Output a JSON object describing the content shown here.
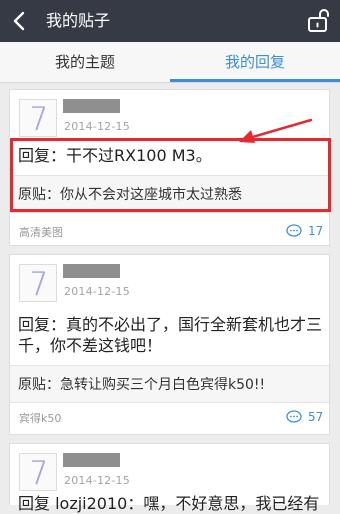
{
  "header": {
    "title": "我的贴子",
    "back_icon": "back-arrow-icon",
    "lock_icon": "lock-icon"
  },
  "tabs": [
    {
      "label": "我的主题",
      "active": false
    },
    {
      "label": "我的回复",
      "active": true
    }
  ],
  "colors": {
    "header_bg": "#363a45",
    "accent": "#3d8ed6",
    "highlight": "#e8282f"
  },
  "posts": [
    {
      "date": "2014-12-15",
      "reply": "回复：干不过RX100 M3。",
      "original": "原贴：你从不会对这座城市太过熟悉",
      "source": "高清美图",
      "comments": "17"
    },
    {
      "date": "2014-12-15",
      "reply": "回复：真的不必出了，国行全新套机也才三千，你不差这钱吧！",
      "original": "原贴：急转让购买三个月白色宾得k50!!",
      "source": "宾得k50",
      "comments": "57"
    },
    {
      "date": "2014-12-15",
      "reply": "回复 lozji2010：嘿，不好意思，我已经有"
    }
  ]
}
